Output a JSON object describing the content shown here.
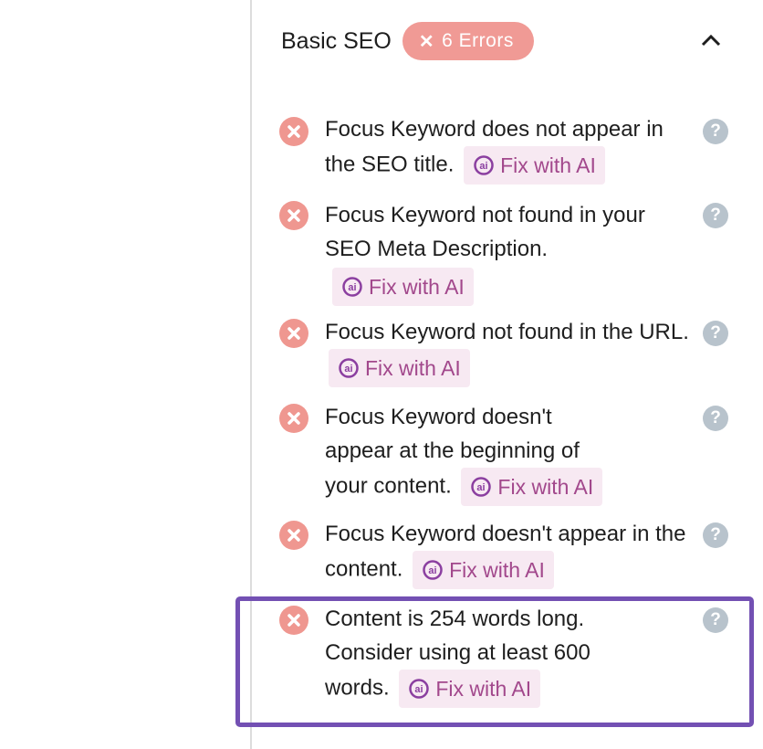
{
  "section": {
    "title": "Basic SEO",
    "badge": {
      "icon": "x-icon",
      "label": "6 Errors",
      "color": "#f09a95"
    },
    "collapse_icon": "chevron-up-icon"
  },
  "fix_label": "Fix with AI",
  "items": [
    {
      "text": "Focus Keyword does not appear in the SEO title.",
      "status": "error",
      "fix": "Fix with AI"
    },
    {
      "text": "Focus Keyword not found in your SEO Meta Description.",
      "status": "error",
      "fix": "Fix with AI"
    },
    {
      "text": "Focus Keyword not found in the URL.",
      "status": "error",
      "fix": "Fix with AI"
    },
    {
      "text": "Focus Keyword doesn't appear at the beginning of your content.",
      "status": "error",
      "fix": "Fix with AI"
    },
    {
      "text": "Focus Keyword doesn't appear in the content.",
      "status": "error",
      "fix": "Fix with AI"
    },
    {
      "text": "Content is 254 words long. Consider using at least 600 words.",
      "status": "error",
      "fix": "Fix with AI",
      "highlighted": true
    }
  ],
  "colors": {
    "error": "#ef9790",
    "help": "#b8c3cc",
    "fix_bg": "#f7e9f2",
    "fix_text": "#a2488c",
    "highlight": "#7350b3"
  }
}
